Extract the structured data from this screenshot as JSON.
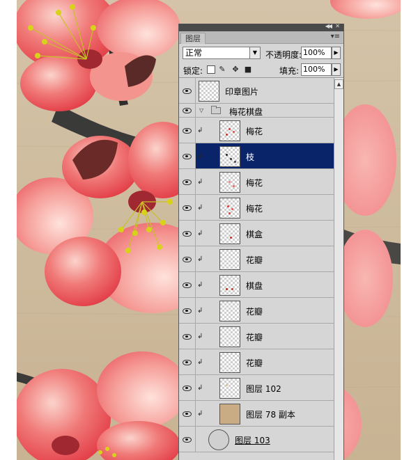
{
  "panel": {
    "tab_label": "图层",
    "menu_icon": "panel-menu-icon",
    "blend_mode": "正常",
    "opacity_label": "不透明度:",
    "opacity_value": "100%",
    "lock_label": "锁定:",
    "fill_label": "填充:",
    "fill_value": "100%"
  },
  "layers": [
    {
      "name": "印章图片",
      "type": "layer",
      "clipped": false,
      "selected": false
    },
    {
      "name": "梅花棋盘",
      "type": "group",
      "clipped": false,
      "selected": false
    },
    {
      "name": "梅花",
      "type": "layer",
      "clipped": true,
      "selected": false
    },
    {
      "name": "枝",
      "type": "layer",
      "clipped": true,
      "selected": true
    },
    {
      "name": "梅花",
      "type": "layer",
      "clipped": true,
      "selected": false
    },
    {
      "name": "梅花",
      "type": "layer",
      "clipped": true,
      "selected": false
    },
    {
      "name": "棋盒",
      "type": "layer",
      "clipped": true,
      "selected": false
    },
    {
      "name": "花瓣",
      "type": "layer",
      "clipped": true,
      "selected": false
    },
    {
      "name": "棋盘",
      "type": "layer",
      "clipped": true,
      "selected": false
    },
    {
      "name": "花瓣",
      "type": "layer",
      "clipped": true,
      "selected": false
    },
    {
      "name": "花瓣",
      "type": "layer",
      "clipped": true,
      "selected": false
    },
    {
      "name": "花瓣",
      "type": "layer",
      "clipped": true,
      "selected": false
    },
    {
      "name": "图层 102",
      "type": "layer",
      "clipped": true,
      "selected": false
    },
    {
      "name": "图层 78 副本",
      "type": "layer",
      "clipped": true,
      "selected": false
    },
    {
      "name": "图层 103",
      "type": "layer",
      "clipped": false,
      "selected": false
    }
  ],
  "colors": {
    "selection": "#0a246a",
    "panel_bg": "#d6d6d6",
    "blossom": "#e8474f",
    "branch": "#3a3a38",
    "stamen": "#d8d21a",
    "canvas_bg": "#cdb79a"
  }
}
